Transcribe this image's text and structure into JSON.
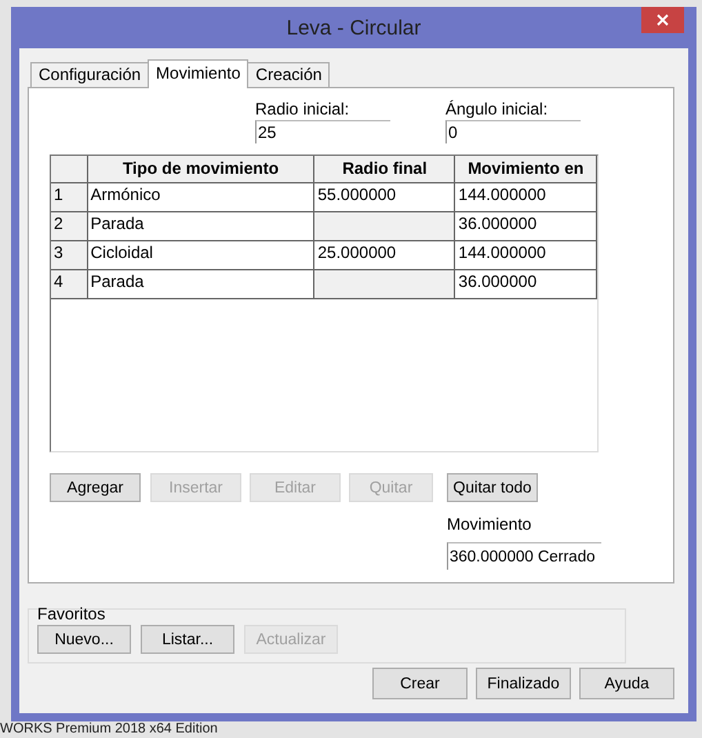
{
  "window": {
    "title": "Leva - Circular"
  },
  "tabs": [
    {
      "label": "Configuración",
      "selected": false
    },
    {
      "label": "Movimiento",
      "selected": true
    },
    {
      "label": "Creación",
      "selected": false
    }
  ],
  "fields": [
    {
      "label": "Radio inicial:",
      "value": "25"
    },
    {
      "label": "Ángulo inicial:",
      "value": "0"
    }
  ],
  "table": {
    "columns": [
      "Tipo de movimiento",
      "Radio final",
      "Movimiento en"
    ],
    "rows": [
      {
        "number": "1",
        "type": "Armónico",
        "radius": "55.000000",
        "radius_disabled": false,
        "motion": "144.000000"
      },
      {
        "number": "2",
        "type": "Parada",
        "radius_disabled": true,
        "motion": "36.000000"
      },
      {
        "number": "3",
        "type": "Cicloidal",
        "radius": "25.000000",
        "radius_disabled": false,
        "motion": "144.000000"
      },
      {
        "number": "4",
        "type": "Parada",
        "radius_disabled": true,
        "motion": "36.000000"
      }
    ]
  },
  "row_buttons": [
    {
      "label": "Agregar",
      "disabled": false
    },
    {
      "label": "Insertar",
      "disabled": true
    },
    {
      "label": "Editar",
      "disabled": true
    },
    {
      "label": "Quitar",
      "disabled": true
    },
    {
      "label": "Quitar todo",
      "disabled": false
    }
  ],
  "total": {
    "label": "Movimiento",
    "value": "360.000000 Cerrado"
  },
  "favorites": {
    "title": "Favoritos",
    "buttons": [
      {
        "label": "Nuevo...",
        "disabled": false
      },
      {
        "label": "Listar...",
        "disabled": false
      },
      {
        "label": "Actualizar",
        "disabled": true
      }
    ]
  },
  "dialog_buttons": [
    {
      "label": "Crear",
      "disabled": false
    },
    {
      "label": "Finalizado",
      "disabled": false
    },
    {
      "label": "Ayuda",
      "disabled": false
    }
  ],
  "status_bar": {
    "text": "WORKS Premium 2018 x64 Edition"
  }
}
